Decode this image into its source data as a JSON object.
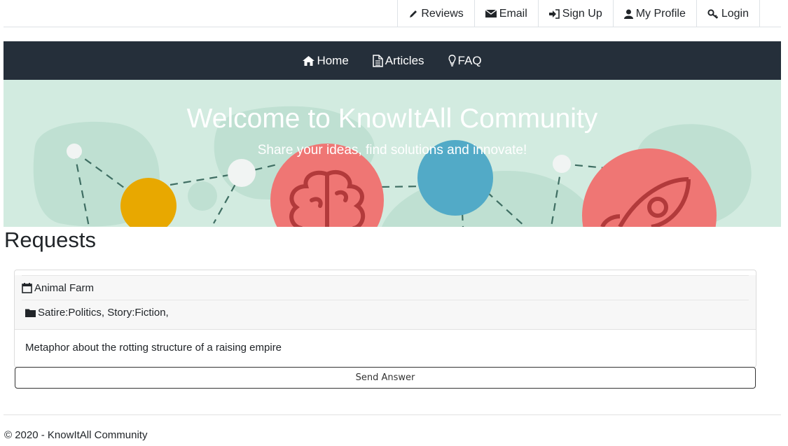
{
  "top_nav": {
    "reviews": "Reviews",
    "email": "Email",
    "sign_up": "Sign Up",
    "my_profile": "My Profile",
    "login": "Login"
  },
  "main_nav": {
    "home": "Home",
    "articles": "Articles",
    "faq": "FAQ"
  },
  "banner": {
    "title": "Welcome to KnowItAll Community",
    "subtitle": "Share your ideas, find solutions and innovate!"
  },
  "page": {
    "heading": "Requests"
  },
  "requests": [
    {
      "title": "Animal Farm",
      "tags": "Satire:Politics, Story:Fiction,",
      "description": "Metaphor about the rotting structure of a raising empire",
      "button_label": "Send Answer"
    }
  ],
  "footer": {
    "text": "© 2020 - KnowItAll Community"
  },
  "colors": {
    "navbar": "#252f3a",
    "banner_bg": "#d2ebe0",
    "blob": "#bfe0d2",
    "yellow": "#e8a800",
    "coral": "#ef7674",
    "blue": "#52aac7"
  },
  "icons": {
    "reviews": "pencil-icon",
    "email": "envelope-icon",
    "sign_up": "sign-in-icon",
    "my_profile": "user-icon",
    "login": "key-icon",
    "home": "home-icon",
    "articles": "file-icon",
    "faq": "lightbulb-icon",
    "request_title": "calendar-icon",
    "request_tags": "folder-icon"
  }
}
